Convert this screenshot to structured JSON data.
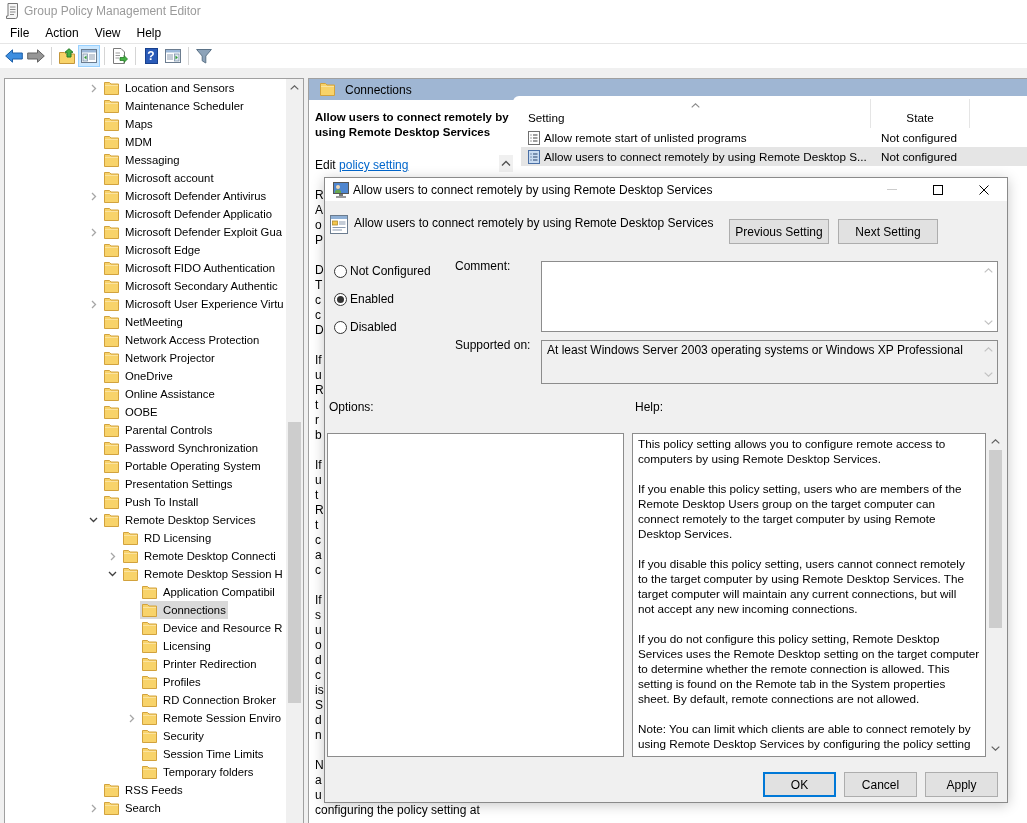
{
  "window": {
    "title": "Group Policy Management Editor",
    "active": false
  },
  "menu": [
    "File",
    "Action",
    "View",
    "Help"
  ],
  "toolbar": {
    "groups": [
      [
        {
          "kind": "back",
          "disabled": false,
          "pressed": false
        },
        {
          "kind": "forward",
          "disabled": true,
          "pressed": false
        }
      ],
      [
        {
          "kind": "up",
          "disabled": false,
          "pressed": false
        },
        {
          "kind": "tree",
          "disabled": false,
          "pressed": true
        }
      ],
      [
        {
          "kind": "export",
          "disabled": false,
          "pressed": false
        }
      ],
      [
        {
          "kind": "help",
          "glyph": "?",
          "disabled": false,
          "pressed": false
        },
        {
          "kind": "pane",
          "disabled": false,
          "pressed": false
        }
      ],
      [
        {
          "kind": "filter",
          "disabled": false,
          "pressed": false
        }
      ]
    ]
  },
  "tree": {
    "items": [
      {
        "label": "Location and Sensors",
        "expanded": false,
        "selected": false
      },
      {
        "label": "Maintenance Scheduler",
        "selected": false
      },
      {
        "label": "Maps",
        "selected": false
      },
      {
        "label": "MDM",
        "selected": false
      },
      {
        "label": "Messaging",
        "selected": false
      },
      {
        "label": "Microsoft account",
        "selected": false
      },
      {
        "label": "Microsoft Defender Antivirus",
        "expanded": false,
        "selected": false
      },
      {
        "label": "Microsoft Defender Applicatio",
        "selected": false
      },
      {
        "label": "Microsoft Defender Exploit Gua",
        "expanded": false,
        "selected": false
      },
      {
        "label": "Microsoft Edge",
        "selected": false
      },
      {
        "label": "Microsoft FIDO Authentication",
        "selected": false
      },
      {
        "label": "Microsoft Secondary Authentic",
        "selected": false
      },
      {
        "label": "Microsoft User Experience Virtu",
        "expanded": false,
        "selected": false
      },
      {
        "label": "NetMeeting",
        "selected": false
      },
      {
        "label": "Network Access Protection",
        "selected": false
      },
      {
        "label": "Network Projector",
        "selected": false
      },
      {
        "label": "OneDrive",
        "selected": false
      },
      {
        "label": "Online Assistance",
        "selected": false
      },
      {
        "label": "OOBE",
        "selected": false
      },
      {
        "label": "Parental Controls",
        "selected": false
      },
      {
        "label": "Password Synchronization",
        "selected": false
      },
      {
        "label": "Portable Operating System",
        "selected": false
      },
      {
        "label": "Presentation Settings",
        "selected": false
      },
      {
        "label": "Push To Install",
        "selected": false
      },
      {
        "label": "Remote Desktop Services",
        "expanded": true,
        "selected": false,
        "children": [
          {
            "label": "RD Licensing",
            "selected": false
          },
          {
            "label": "Remote Desktop Connecti",
            "expanded": false,
            "selected": false
          },
          {
            "label": "Remote Desktop Session H",
            "expanded": true,
            "selected": false,
            "children": [
              {
                "label": "Application Compatibil",
                "selected": false
              },
              {
                "label": "Connections",
                "selected": true
              },
              {
                "label": "Device and Resource R",
                "selected": false
              },
              {
                "label": "Licensing",
                "selected": false
              },
              {
                "label": "Printer Redirection",
                "selected": false
              },
              {
                "label": "Profiles",
                "selected": false
              },
              {
                "label": "RD Connection Broker",
                "selected": false
              },
              {
                "label": "Remote Session Enviro",
                "expanded": false,
                "selected": false
              },
              {
                "label": "Security",
                "selected": false
              },
              {
                "label": "Session Time Limits",
                "selected": false
              },
              {
                "label": "Temporary folders",
                "selected": false
              }
            ]
          }
        ]
      },
      {
        "label": "RSS Feeds",
        "selected": false
      },
      {
        "label": "Search",
        "expanded": false,
        "selected": false
      }
    ]
  },
  "details": {
    "header": "Connections",
    "description": {
      "title": "Allow users to connect remotely by using Remote Desktop Services",
      "edit_prefix": "Edit",
      "edit_link": "policy setting",
      "fragments": [
        [
          "R",
          "A",
          "o",
          "P"
        ],
        [
          "D",
          "T",
          "c",
          "c",
          "D"
        ],
        [
          "If",
          "u",
          "R",
          "t",
          "r",
          "b"
        ],
        [
          "If",
          "u",
          "t",
          "R",
          "t",
          "c",
          "a",
          "c"
        ],
        [
          "If",
          "s",
          "u",
          "o",
          "d",
          "c",
          "is",
          "S",
          "d",
          "n"
        ],
        [
          "N",
          "a",
          "u",
          "configuring the policy setting at"
        ]
      ]
    },
    "list": {
      "columns": [
        {
          "label": "Setting",
          "sorted": true
        },
        {
          "label": "State",
          "sorted": false
        }
      ],
      "rows": [
        {
          "setting": "Allow remote start of unlisted programs",
          "state": "Not configured",
          "selected": false
        },
        {
          "setting": "Allow users to connect remotely by using Remote Desktop S...",
          "state": "Not configured",
          "selected": true
        }
      ]
    }
  },
  "dialog": {
    "title": "Allow users to connect remotely by using Remote Desktop Services",
    "controls": [
      {
        "kind": "minimize",
        "disabled": true
      },
      {
        "kind": "maximize",
        "disabled": false
      },
      {
        "kind": "close",
        "disabled": false
      }
    ],
    "heading": "Allow users to connect remotely by using Remote Desktop Services",
    "nav_buttons": [
      "Previous Setting",
      "Next Setting"
    ],
    "states": [
      {
        "label": "Not Configured",
        "selected": false
      },
      {
        "label": "Enabled",
        "selected": true
      },
      {
        "label": "Disabled",
        "selected": false
      }
    ],
    "comment": {
      "label": "Comment:"
    },
    "supported": {
      "label": "Supported on:",
      "value": "At least Windows Server 2003 operating systems or Windows XP Professional"
    },
    "options": {
      "label": "Options:"
    },
    "help": {
      "label": "Help:",
      "paragraphs": [
        "This policy setting allows you to configure remote access to\ncomputers by using Remote Desktop Services.",
        "If you enable this policy setting, users who are members of the\nRemote Desktop Users group on the target computer can\nconnect remotely to the target computer by using Remote\nDesktop Services.",
        "If you disable this policy setting, users cannot connect remotely\nto the target computer by using Remote Desktop Services. The\ntarget computer will maintain any current connections, but will\nnot accept any new incoming connections.",
        "If you do not configure this policy setting, Remote Desktop\nServices uses the Remote Desktop setting on the target computer\nto determine whether the remote connection is allowed. This\nsetting is found on the Remote tab in the System properties\nsheet. By default, remote connections are not allowed.",
        "Note: You can limit which clients are able to connect remotely by\nusing Remote Desktop Services by configuring the policy setting"
      ]
    },
    "buttons": [
      {
        "label": "OK",
        "default": true
      },
      {
        "label": "Cancel",
        "default": false
      },
      {
        "label": "Apply",
        "default": false
      }
    ]
  }
}
